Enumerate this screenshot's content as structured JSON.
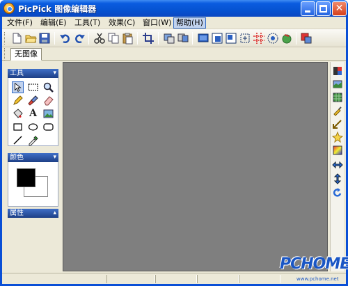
{
  "window": {
    "title": "PicPick 图像编辑器"
  },
  "menu": {
    "items": [
      {
        "label": "文件(F)"
      },
      {
        "label": "编辑(E)"
      },
      {
        "label": "工具(T)"
      },
      {
        "label": "效果(C)"
      },
      {
        "label": "窗口(W)"
      },
      {
        "label": "帮助(H)"
      }
    ]
  },
  "toolbar": {
    "icons": [
      "new-icon",
      "open-icon",
      "save-icon",
      "undo-icon",
      "redo-icon",
      "cut-icon",
      "copy-icon",
      "paste-icon",
      "crop-icon",
      "capture-icon",
      "capture-window-icon",
      "capture-fullscreen-icon",
      "capture-active-icon",
      "capture-region-icon",
      "capture-fixed-icon",
      "capture-freehand-icon",
      "capture-scroll-icon",
      "share-icon"
    ]
  },
  "tabs": [
    {
      "label": "无图像"
    }
  ],
  "panels": {
    "tools": {
      "title": "工具",
      "items": [
        "select-arrow",
        "select-rect",
        "zoom",
        "pencil",
        "brush",
        "eraser",
        "fill",
        "text",
        "image",
        "rectangle",
        "ellipse",
        "rounded-rect",
        "line",
        "color-picker"
      ]
    },
    "color": {
      "title": "颜色",
      "foreground": "#000000",
      "background": "#ffffff"
    },
    "properties": {
      "title": "属性"
    }
  },
  "right_toolbar": {
    "icons": [
      "color-adjust-icon",
      "flip-icon",
      "mosaic-icon",
      "sharpen-icon",
      "resize-icon",
      "effect-icon",
      "gradient-icon",
      "flip-horizontal-icon",
      "flip-vertical-icon",
      "rotate-icon"
    ]
  },
  "watermark": {
    "brand": "PCHOME",
    "url": "www.pchome.net"
  },
  "colors": {
    "title_bar": "#0653d2",
    "client": "#ece9d8",
    "canvas": "#7f7f7f",
    "panel_head": "#1d3f86"
  }
}
